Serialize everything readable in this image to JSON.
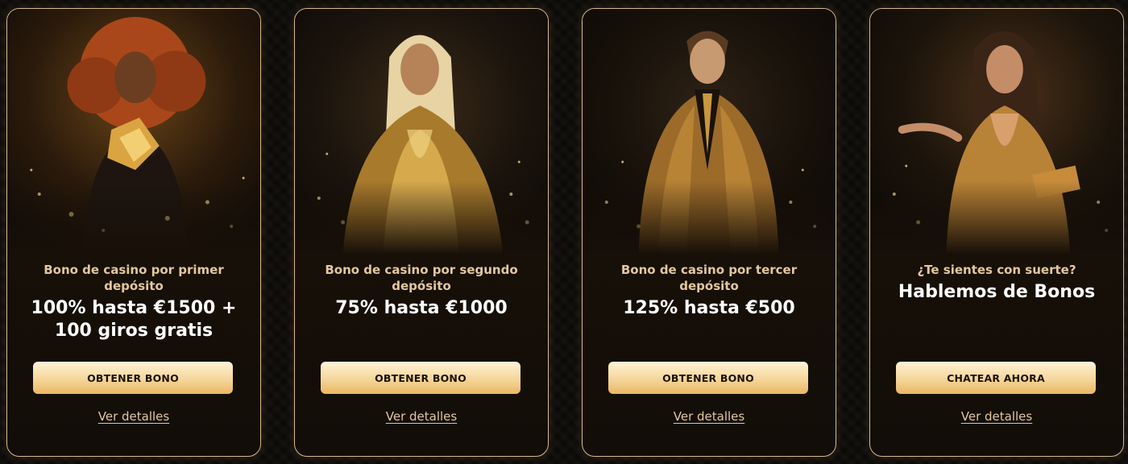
{
  "cards": [
    {
      "subtitle": "Bono de casino por primer depósito",
      "headline": "100% hasta €1500 + 100 giros gratis",
      "button_label": "OBTENER BONO",
      "details_label": "Ver detalles",
      "image": "woman-red-curly-hair-gold-ornament"
    },
    {
      "subtitle": "Bono de casino por segundo depósito",
      "headline": "75% hasta €1000",
      "button_label": "OBTENER BONO",
      "details_label": "Ver detalles",
      "image": "woman-platinum-hair-gold-dress"
    },
    {
      "subtitle": "Bono de casino por tercer depósito",
      "headline": "125% hasta €500",
      "button_label": "OBTENER BONO",
      "details_label": "Ver detalles",
      "image": "man-gold-suit"
    },
    {
      "subtitle": "¿Te sientes con suerte?",
      "headline": "Hablemos de Bonos",
      "button_label": "CHATEAR AHORA",
      "details_label": "Ver detalles",
      "image": "woman-gold-dress-treasure"
    }
  ],
  "colors": {
    "accent": "#e3c79e",
    "border": "#d8b98a",
    "button_top": "#fff3d6",
    "button_bottom": "#e9b763",
    "background": "#0d0b08"
  }
}
